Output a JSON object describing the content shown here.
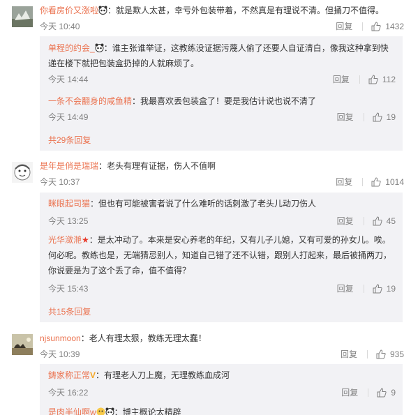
{
  "reply_label": "回复",
  "comments": [
    {
      "user": "你看房价又涨啦",
      "text": "：就是欺人太甚，幸亏外包装带着，不然真是有理说不清。但捅刀不值得。",
      "time": "今天 10:40",
      "likes": "1432",
      "replies": [
        {
          "user": "单程的约会_",
          "text": "：谁主张谁举证，这教练没证据污蔑人偷了还要人自证清白，像我这种拿到快递在楼下就把包装盒扔掉的人就麻烦了。",
          "time": "今天 14:44",
          "likes": "112"
        },
        {
          "user": "一条不会翻身的咸鱼精",
          "text": "：我最喜欢丢包装盒了！要是我估计说也说不清了",
          "time": "今天 14:49",
          "likes": "19"
        }
      ],
      "more": "共29条回复"
    },
    {
      "user": "是年是俏是瑞瑞",
      "text": "：老头有理有证据，伤人不值啊",
      "time": "今天 10:37",
      "likes": "1014",
      "replies": [
        {
          "user": "眯眼起司猫",
          "text": "：但也有可能被害者说了什么难听的话刺激了老头儿动刀伤人",
          "time": "今天 13:25",
          "likes": "45"
        },
        {
          "user": "光华潋滟",
          "text": "：是太冲动了。本来是安心养老的年纪，又有儿子儿媳，又有可爱的孙女儿。唉。何必呢。教练也是，无端猜忌别人，知道自己错了还不认错，跟别人打起来，最后被捅两刀，你说要是为了这个丢了命，值不值得？",
          "time": "今天 15:43",
          "likes": "19"
        }
      ],
      "more": "共15条回复"
    },
    {
      "user": "njsunmoon",
      "text": "：老人有理太狠，教练无理太蠢！",
      "time": "今天 10:39",
      "likes": "935",
      "replies": [
        {
          "user": "鋳家称正常",
          "text": "：有理老人刀上魔，无理教练血成河",
          "time": "今天 16:22",
          "likes": "9"
        },
        {
          "user": "是肉半仙啊w",
          "text": "：博主概论太精辟",
          "time": "",
          "likes": ""
        }
      ],
      "more": ""
    }
  ],
  "colors": {
    "username": "#eb7350",
    "muted": "#808080",
    "sub_bg": "#f2f2f5"
  }
}
